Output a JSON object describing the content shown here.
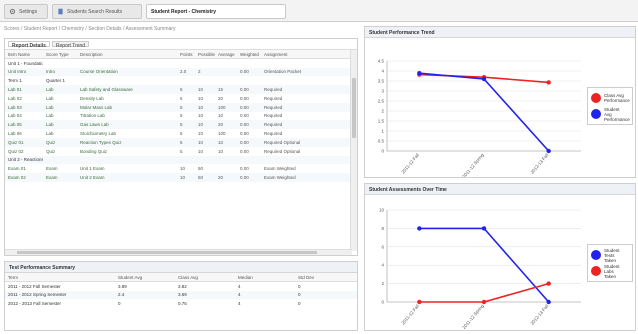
{
  "tabs": [
    {
      "label": "Settings",
      "icon": "gear-icon",
      "active": false
    },
    {
      "label": "Students Search Results",
      "icon": "document-icon",
      "active": false
    },
    {
      "label": "Student Report - Chemistry",
      "icon": "",
      "active": true
    }
  ],
  "breadcrumb": "Scores / Student Report / Chemistry / Section Details / Assessment Summary",
  "main_panel": {
    "subtabs": [
      "Report Details",
      "Report Trend"
    ],
    "columns": [
      "Item Name",
      "Score Type",
      "Description",
      "Points",
      "Possible",
      "Average",
      "Weighted",
      "Assignment"
    ],
    "rows": [
      {
        "type": "group",
        "cells": [
          "Unit 1 - Foundations",
          "",
          "",
          "",
          "",
          "",
          "",
          ""
        ]
      },
      {
        "type": "row",
        "cells": [
          "Unit Intro",
          "Intro",
          "Course Orientation",
          "2.0",
          "2",
          "",
          "0.00",
          "Orientation Packet"
        ]
      },
      {
        "type": "group",
        "cells": [
          "Term 1",
          "Quarter 1",
          "",
          "",
          "",
          "",
          "",
          ""
        ]
      },
      {
        "type": "row",
        "cells": [
          "Lab 01",
          "Lab",
          "Lab Safety and Glassware",
          "5",
          "10",
          "15",
          "0.00",
          "Required"
        ]
      },
      {
        "type": "row",
        "cells": [
          "Lab 02",
          "Lab",
          "Density Lab",
          "5",
          "10",
          "20",
          "0.00",
          "Required"
        ]
      },
      {
        "type": "row",
        "cells": [
          "Lab 03",
          "Lab",
          "Molar Mass Lab",
          "5",
          "10",
          "100",
          "0.00",
          "Required"
        ]
      },
      {
        "type": "row",
        "cells": [
          "Lab 04",
          "Lab",
          "Titration Lab",
          "5",
          "10",
          "10",
          "0.00",
          "Required"
        ]
      },
      {
        "type": "row",
        "cells": [
          "Lab 05",
          "Lab",
          "Gas Laws Lab",
          "5",
          "10",
          "20",
          "0.00",
          "Required"
        ]
      },
      {
        "type": "row",
        "cells": [
          "Lab 06",
          "Lab",
          "Stoichiometry Lab",
          "5",
          "10",
          "100",
          "0.00",
          "Required"
        ]
      },
      {
        "type": "row",
        "cells": [
          "Quiz 01",
          "Quiz",
          "Reaction Types Quiz",
          "5",
          "10",
          "10",
          "0.00",
          "Required Optional"
        ]
      },
      {
        "type": "row",
        "cells": [
          "Quiz 02",
          "Quiz",
          "Bonding Quiz",
          "5",
          "10",
          "10",
          "0.00",
          "Required Optional"
        ]
      },
      {
        "type": "group",
        "cells": [
          "Unit 2 - Reactions",
          "",
          "",
          "",
          "",
          "",
          "",
          ""
        ]
      },
      {
        "type": "row",
        "cells": [
          "Exam 01",
          "Exam",
          "Unit 1 Exam",
          "10",
          "50",
          "",
          "0.00",
          "Exam Weighted"
        ]
      },
      {
        "type": "row",
        "cells": [
          "Exam 02",
          "Exam",
          "Unit 2 Exam",
          "10",
          "50",
          "20",
          "0.00",
          "Exam Weighted"
        ]
      }
    ]
  },
  "summary_panel": {
    "title": "Test Performance Summary",
    "columns": [
      "Term",
      "Student Avg",
      "Class Avg",
      "Median",
      "Std Dev"
    ],
    "rows": [
      [
        "2011 - 2012 Fall Semester",
        "3.89",
        "3.82",
        "4",
        "0"
      ],
      [
        "2011 - 2012 Spring Semester",
        "2.4",
        "3.69",
        "4",
        "0"
      ],
      [
        "2012 - 2013 Fall Semester",
        "0",
        "0.75",
        "4",
        "0"
      ]
    ]
  },
  "chart_top": {
    "title": "Student Performance Trend",
    "chart_data": {
      "type": "line",
      "categories": [
        "2011-12 Fall",
        "2011-12 Spring",
        "2012-13 Fall"
      ],
      "ylim": [
        0,
        4.5
      ],
      "yticks": [
        "0",
        "0.5",
        "1",
        "1.5",
        "2",
        "2.5",
        "3",
        "3.5",
        "4",
        "4.5"
      ],
      "series": [
        {
          "name": "Class Avg Performance",
          "color": "#ee2222",
          "values": [
            3.82,
            3.69,
            3.43
          ]
        },
        {
          "name": "Student Avg Performance",
          "color": "#2222ee",
          "values": [
            3.89,
            3.6,
            0
          ]
        }
      ]
    }
  },
  "chart_bottom": {
    "title": "Student Assessments Over Time",
    "chart_data": {
      "type": "line",
      "categories": [
        "2011-12 Fall",
        "2011-12 Spring",
        "2012-13 Fall"
      ],
      "ylim": [
        0,
        10
      ],
      "yticks": [
        "0",
        "2",
        "4",
        "6",
        "8",
        "10"
      ],
      "series": [
        {
          "name": "Student Tests Taken",
          "color": "#2222ee",
          "values": [
            8,
            8,
            0
          ]
        },
        {
          "name": "Student Labs Taken",
          "color": "#ee2222",
          "values": [
            0,
            0,
            2
          ]
        }
      ]
    }
  }
}
